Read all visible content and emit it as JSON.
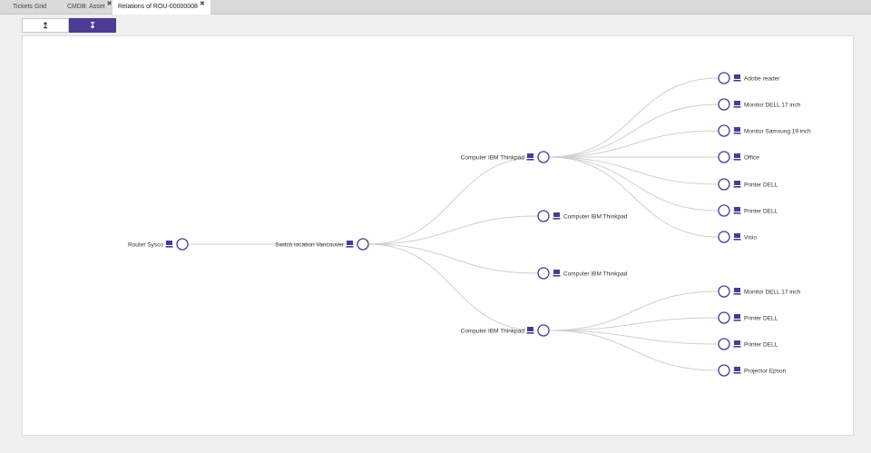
{
  "tabs": [
    {
      "label": "Tickets Grid",
      "closable": false
    },
    {
      "label": "CMDB: Asset",
      "closable": true
    },
    {
      "label": "Relations of ROU-00000008",
      "closable": true
    }
  ],
  "tab_close_glyph": "✖",
  "toolbar": {
    "up_label": "↥",
    "down_label": "↧",
    "active": "down"
  },
  "colors": {
    "accent": "#4b3b95",
    "edge": "#cfcfcf",
    "background": "#efefef"
  },
  "graph": {
    "root": "Router Sysco",
    "nodes": [
      {
        "id": "router",
        "label": "Router Sysco",
        "icon": "computer-icon"
      },
      {
        "id": "switch",
        "label": "Switch location Vancouver",
        "icon": "computer-icon"
      },
      {
        "id": "c1",
        "label": "Computer IBM Thinkpad",
        "icon": "computer-icon"
      },
      {
        "id": "c2",
        "label": "Computer IBM Thinkpad",
        "icon": "computer-icon"
      },
      {
        "id": "c3",
        "label": "Computer IBM Thinkpad",
        "icon": "computer-icon"
      },
      {
        "id": "c4",
        "label": "Computer IBM Thinkpad",
        "icon": "computer-icon"
      },
      {
        "id": "l1",
        "label": "Adobe reader",
        "icon": "computer-icon"
      },
      {
        "id": "l2",
        "label": "Monitor DELL 17 inch",
        "icon": "computer-icon"
      },
      {
        "id": "l3",
        "label": "Monitor Samsung 19 inch",
        "icon": "computer-icon"
      },
      {
        "id": "l4",
        "label": "Office",
        "icon": "computer-icon"
      },
      {
        "id": "l5",
        "label": "Printer DELL",
        "icon": "computer-icon"
      },
      {
        "id": "l6",
        "label": "Printer DELL",
        "icon": "computer-icon"
      },
      {
        "id": "l7",
        "label": "Visio",
        "icon": "computer-icon"
      },
      {
        "id": "l8",
        "label": "Monitor DELL 17 inch",
        "icon": "computer-icon"
      },
      {
        "id": "l9",
        "label": "Printer DELL",
        "icon": "computer-icon"
      },
      {
        "id": "l10",
        "label": "Printer DELL",
        "icon": "computer-icon"
      },
      {
        "id": "l11",
        "label": "Projector Epson",
        "icon": "computer-icon"
      }
    ],
    "edges": [
      [
        "router",
        "switch"
      ],
      [
        "switch",
        "c1"
      ],
      [
        "switch",
        "c2"
      ],
      [
        "switch",
        "c3"
      ],
      [
        "switch",
        "c4"
      ],
      [
        "c1",
        "l1"
      ],
      [
        "c1",
        "l2"
      ],
      [
        "c1",
        "l3"
      ],
      [
        "c1",
        "l4"
      ],
      [
        "c1",
        "l5"
      ],
      [
        "c1",
        "l6"
      ],
      [
        "c1",
        "l7"
      ],
      [
        "c4",
        "l8"
      ],
      [
        "c4",
        "l9"
      ],
      [
        "c4",
        "l10"
      ],
      [
        "c4",
        "l11"
      ]
    ]
  }
}
